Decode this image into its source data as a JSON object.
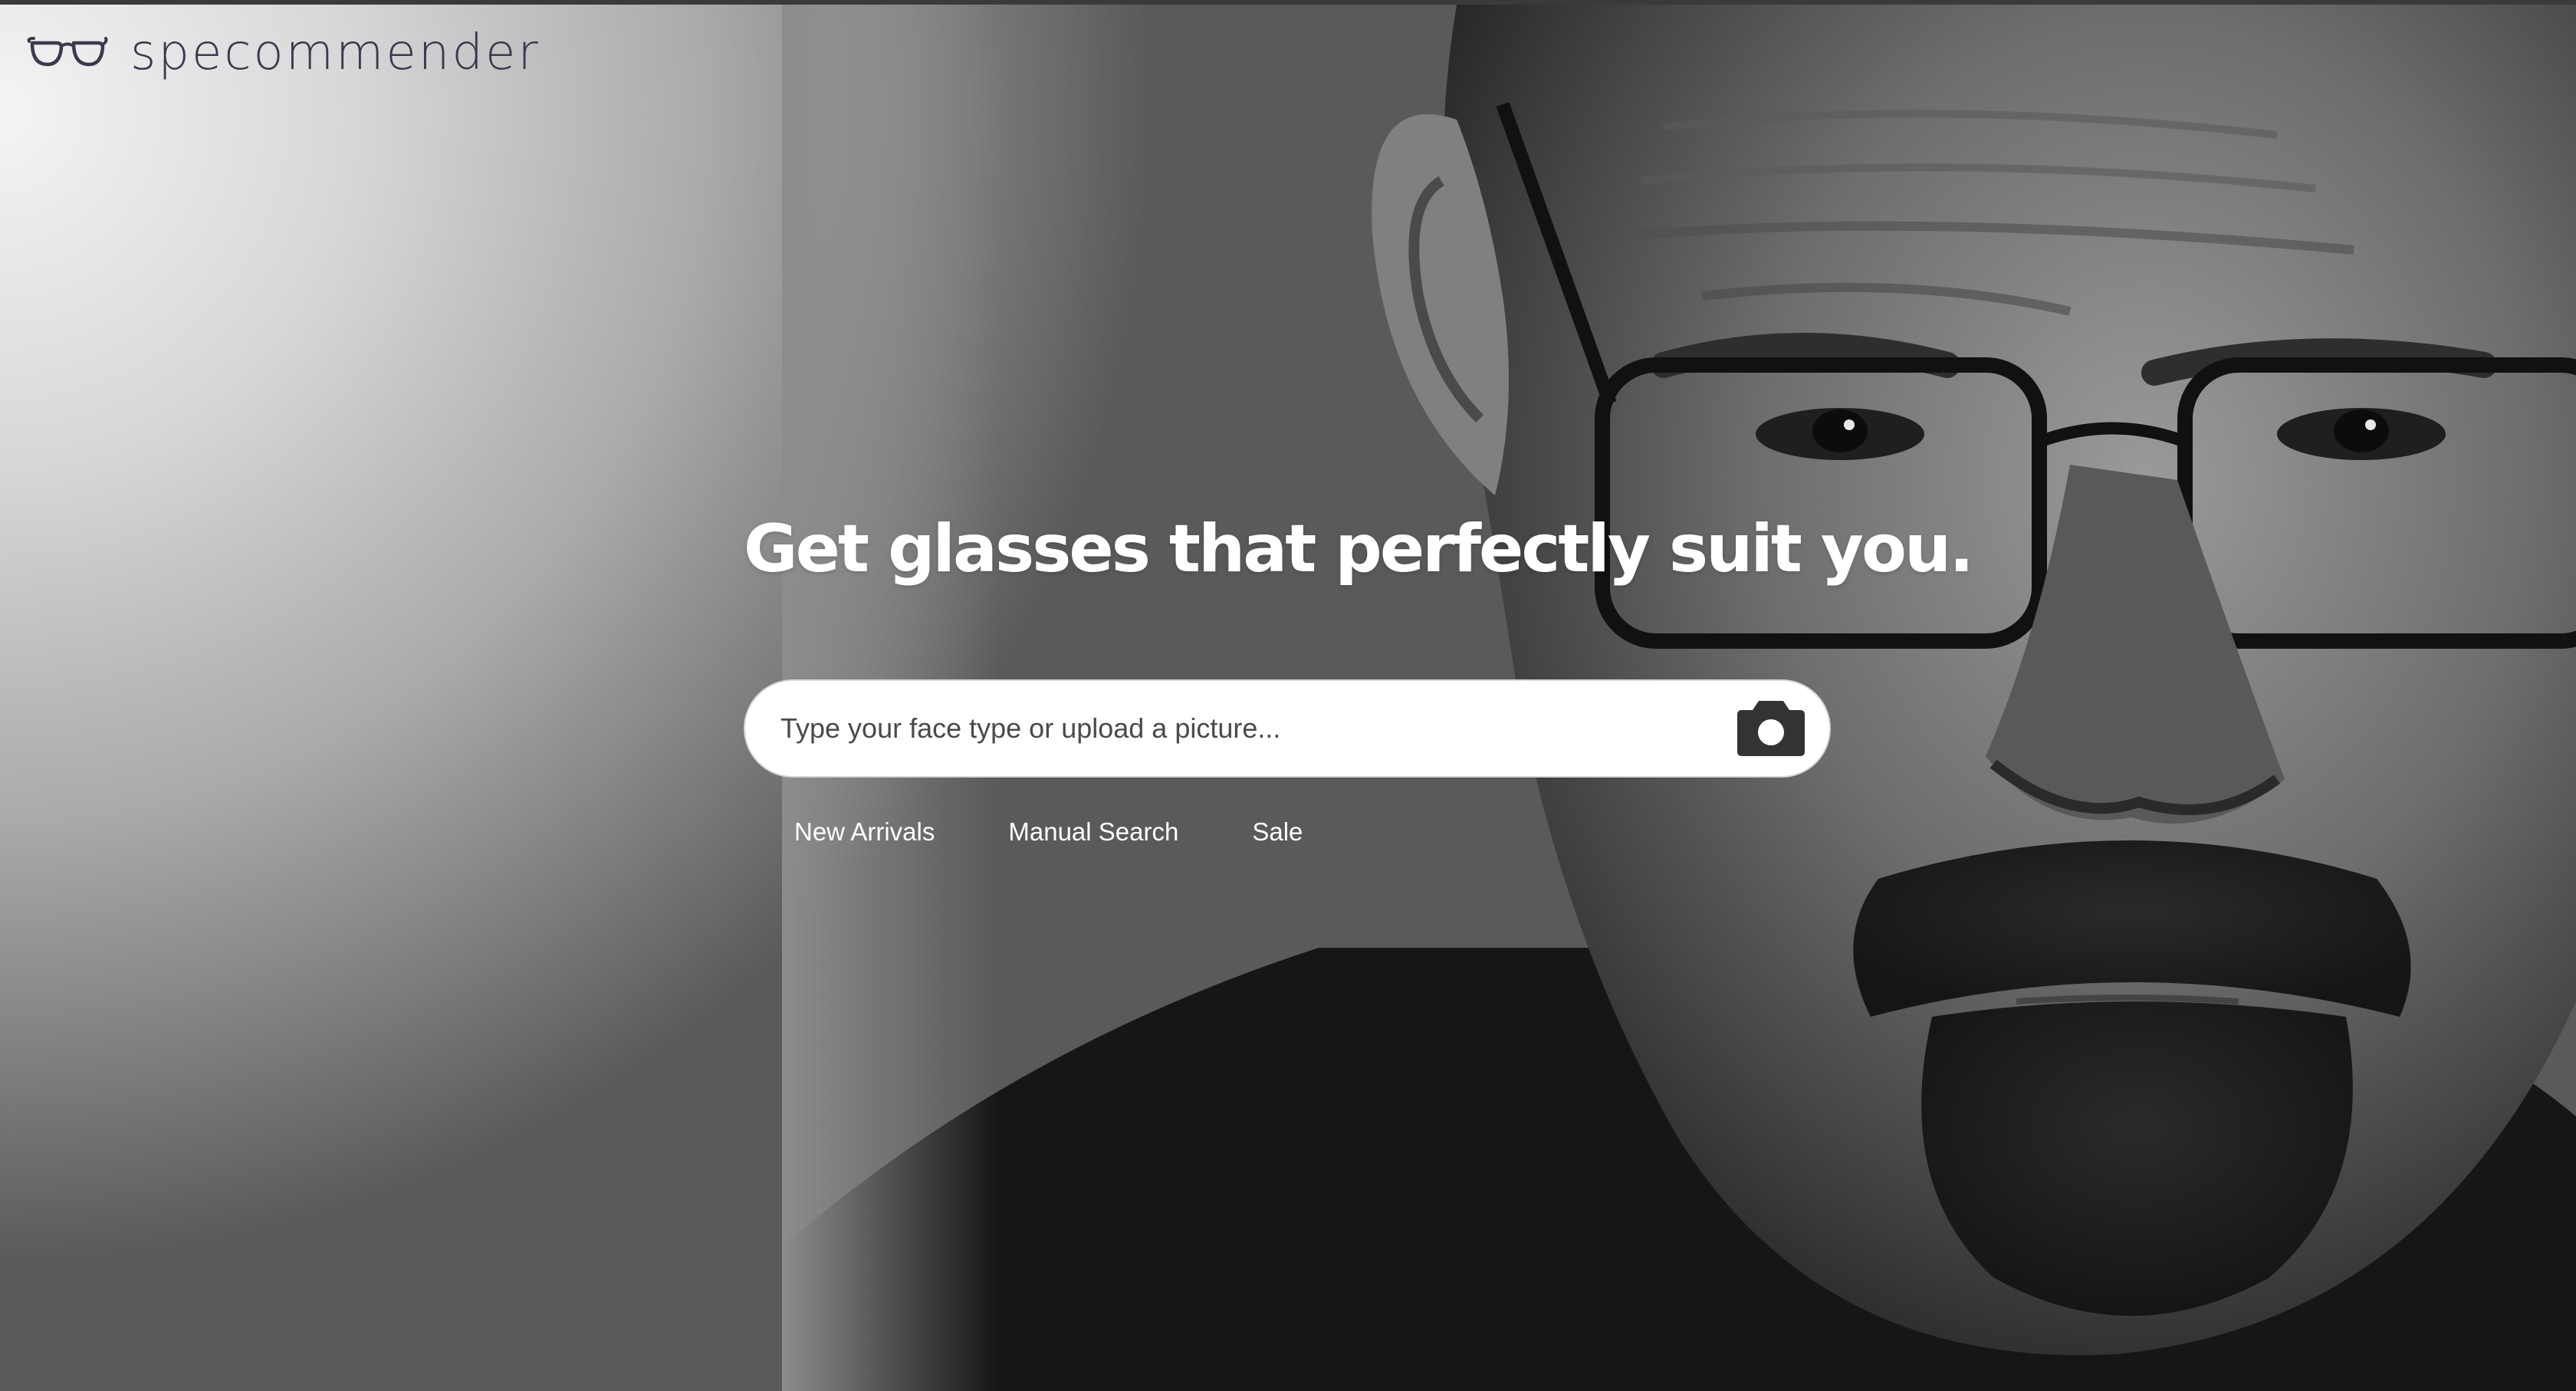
{
  "brand": {
    "name": "specommender",
    "logo_icon": "glasses-icon"
  },
  "hero": {
    "headline": "Get glasses that perfectly suit you."
  },
  "search": {
    "placeholder": "Type your face type or upload a picture...",
    "value": "",
    "upload_icon": "camera-icon"
  },
  "quick_links": [
    {
      "label": "New Arrivals"
    },
    {
      "label": "Manual Search"
    },
    {
      "label": "Sale"
    }
  ],
  "background": {
    "photo": "man-wearing-glasses-photo"
  }
}
